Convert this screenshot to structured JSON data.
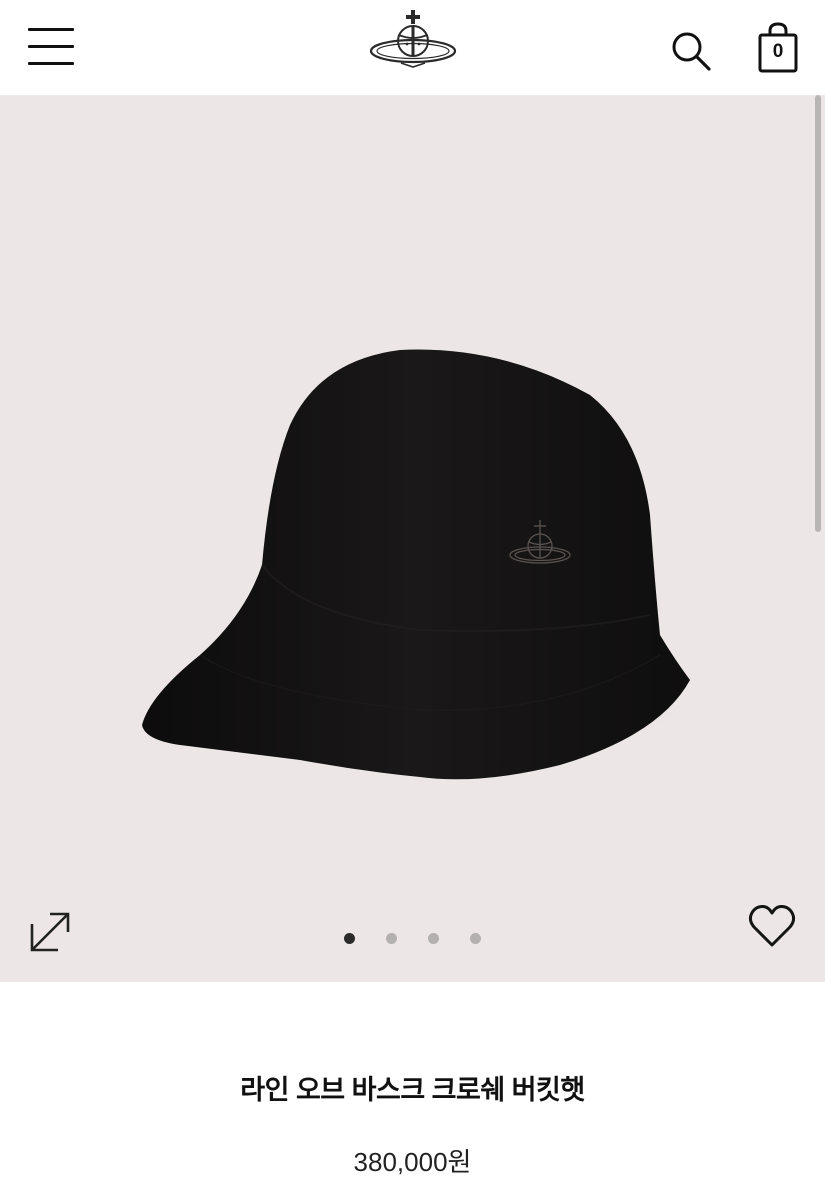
{
  "header": {
    "menu_icon": "hamburger-menu-icon",
    "logo_icon": "orb-logo-icon",
    "search_icon": "search-icon",
    "bag_icon": "shopping-bag-icon",
    "cart_count": "0"
  },
  "gallery": {
    "share_icon": "share-external-icon",
    "wishlist_icon": "heart-outline-icon",
    "slide_count": 4,
    "active_slide": 1,
    "background_color": "#ece7e6"
  },
  "product": {
    "name": "라인 오브 바스크 크로쉐 버킷햇",
    "price": "380,000원"
  }
}
